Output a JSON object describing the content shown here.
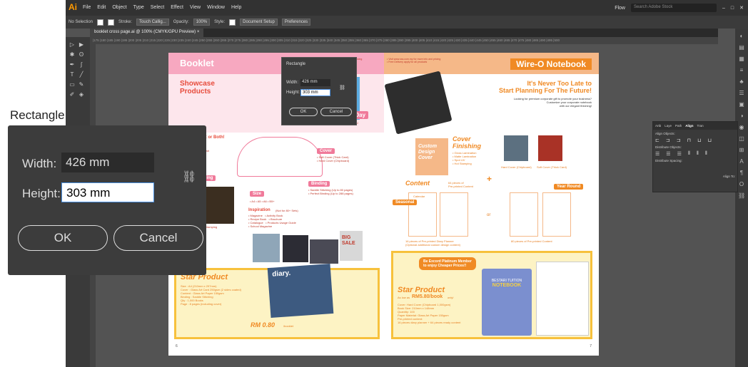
{
  "app": {
    "logo": "Ai",
    "menus": [
      "File",
      "Edit",
      "Object",
      "Type",
      "Select",
      "Effect",
      "View",
      "Window",
      "Help"
    ],
    "workspace": "Flow",
    "search_placeholder": "Search Adobe Stock"
  },
  "control_bar": {
    "selection": "No Selection",
    "stroke_label": "Stroke:",
    "brush": "Touch Callig...",
    "opacity_label": "Opacity:",
    "opacity": "100%",
    "style_label": "Style:",
    "doc_setup": "Document Setup",
    "preferences": "Preferences"
  },
  "document_tab": {
    "title": "booklet cross page.ai @ 100% (CMYK/GPU Preview)",
    "close": "×"
  },
  "ruler_ticks": "|175 |180 |185 |190 |195 |200 |205 |210 |215 |220 |225 |230 |235 |240 |245 |250 |255 |260 |265 |270 |275 |280 |285 |290 |295 |300 |305 |310 |315 |320 |325 |330 |335 |340 |345 |350 |355 |360 |365 |370 |375 |380 |385 |390 |395 |400 |405 |410 |415 |420 |425 |430 |435 |440 |445 |450 |455 |460 |465 |470 |475 |480 |485 |490 |495 |500",
  "artwork": {
    "left_title": "Booklet",
    "left_showcase": "Showcase Products",
    "left_promo": "• Visit www.sss.com.my for more info and pricing\n• Free Delivery apply for all products",
    "process_day": "Process Day",
    "process_sub": "As Fast As 2 Days!",
    "super_english": "SUPER ENGLISH",
    "print_both": "Print or Both!",
    "varnish": "Varnish",
    "cover": "Cover",
    "cover_opts": "• Soft Cover (Thick Card)\n• Hard Cover (Chipboard)",
    "binding": "Binding",
    "binding_opts": "• Saddle Stitching (Up to 80 pages)\n• Perfect Binding (Up to 288 pages)",
    "size": "Size",
    "size_opts": "• A4   • A5   • A6   • B5+",
    "inspiration": "Inspiration",
    "inspiration_sub": "(Not for 80+ Sets)",
    "insp_list": "• Magazine   • Activity Book\n• Recipe Book   • Brochure\n• Catalogue   • Products Usage Guide\n• School Magazine",
    "hot_stamping": "Hot Stamping",
    "pling": "pling",
    "big_sale": "BIG SALE",
    "star_left": "Star Product",
    "star_left_spec": "Size : A4 (210mm x 297mm)\nCover : Glass Art Card 250gsm (2 sides coated)\nContent : Glass Art Paper 150gsm\nBinding : Saddle Stitching\nQty : 1,000 Books\nPage : 8 pages (including cover)",
    "price_left": "RM 0.80",
    "price_left_unit": "/booklet",
    "diary": "diary.",
    "page_left": "6",
    "right_title": "Wire-O Notebook",
    "right_promo": "• Visit www.sss.com.my for more info and pricing\n• Free Delivery apply for all products",
    "never_late": "It's Never Too Late to",
    "start_planning": "Start Planning For The Future!",
    "premium_text": "Looking for premium corporate gift to promote your business?\nCustomize your corporate notebook\nwith our elegant finishing!",
    "custom_design": "Custom Design Cover",
    "cover_finishing": "Cover Finishing",
    "finishing_list": "• Gloss Lamination\n• Matte Lamination\n• Spot UV\n• Hot Stamping",
    "hard_cover": "Hard Cover (Chipboard)",
    "soft_cover": "Soft Cover (Thick Card)",
    "content": "Content",
    "content_note": "64 pieces of\nPre-printed Content",
    "calendar": "Calendar",
    "seasonal": "Seasonal",
    "year_round": "Year Round",
    "plus": "+",
    "or": "or",
    "diary_planner": "16 pieces of Pre-printed Diary Planner\n(Optional additional custom design content)",
    "pre80": "80 pieces of Pre-printed Content",
    "member": "Be Excord Platinum Member\nto enjoy Cheaper Prices!!",
    "star_right": "Star Product",
    "price_right_prefix": "As low as",
    "price_right": "RM5.80/book",
    "price_right_suffix": "only!",
    "star_right_spec": "Cover: Hard Cover (Chipboard 1,000gsm)\nBook Size: 210mm x 148mm\nQuantity: 100\nPaper Material: Glass Art Paper 150gsm\nPre-printed content:\n16 pieces diary planner + 64 pieces ready content",
    "bestari": "BESTARI TUITION",
    "notebook": "NOTEBOOK",
    "page_right": "7"
  },
  "small_dialog": {
    "title": "Rectangle",
    "width_label": "Width:",
    "width": "426 mm",
    "height_label": "Height:",
    "height": "303 mm",
    "ok": "OK",
    "cancel": "Cancel"
  },
  "align_panel": {
    "tabs": [
      "Artb",
      "Laye",
      "Path",
      "Align",
      "Tran"
    ],
    "align_objects": "Align Objects:",
    "distribute_objects": "Distribute Objects:",
    "distribute_spacing": "Distribute Spacing:",
    "align_to": "Align To:"
  },
  "zoom_dialog": {
    "title": "Rectangle",
    "width_label": "Width:",
    "width": "426 mm",
    "height_label": "Height:",
    "height": "303 mm",
    "ok": "OK",
    "cancel": "Cancel"
  },
  "colors": {
    "accent_orange": "#f08a24",
    "pink": "#f7a8c0",
    "dialog_bg": "#3c3c3c",
    "app_bg": "#535353"
  }
}
